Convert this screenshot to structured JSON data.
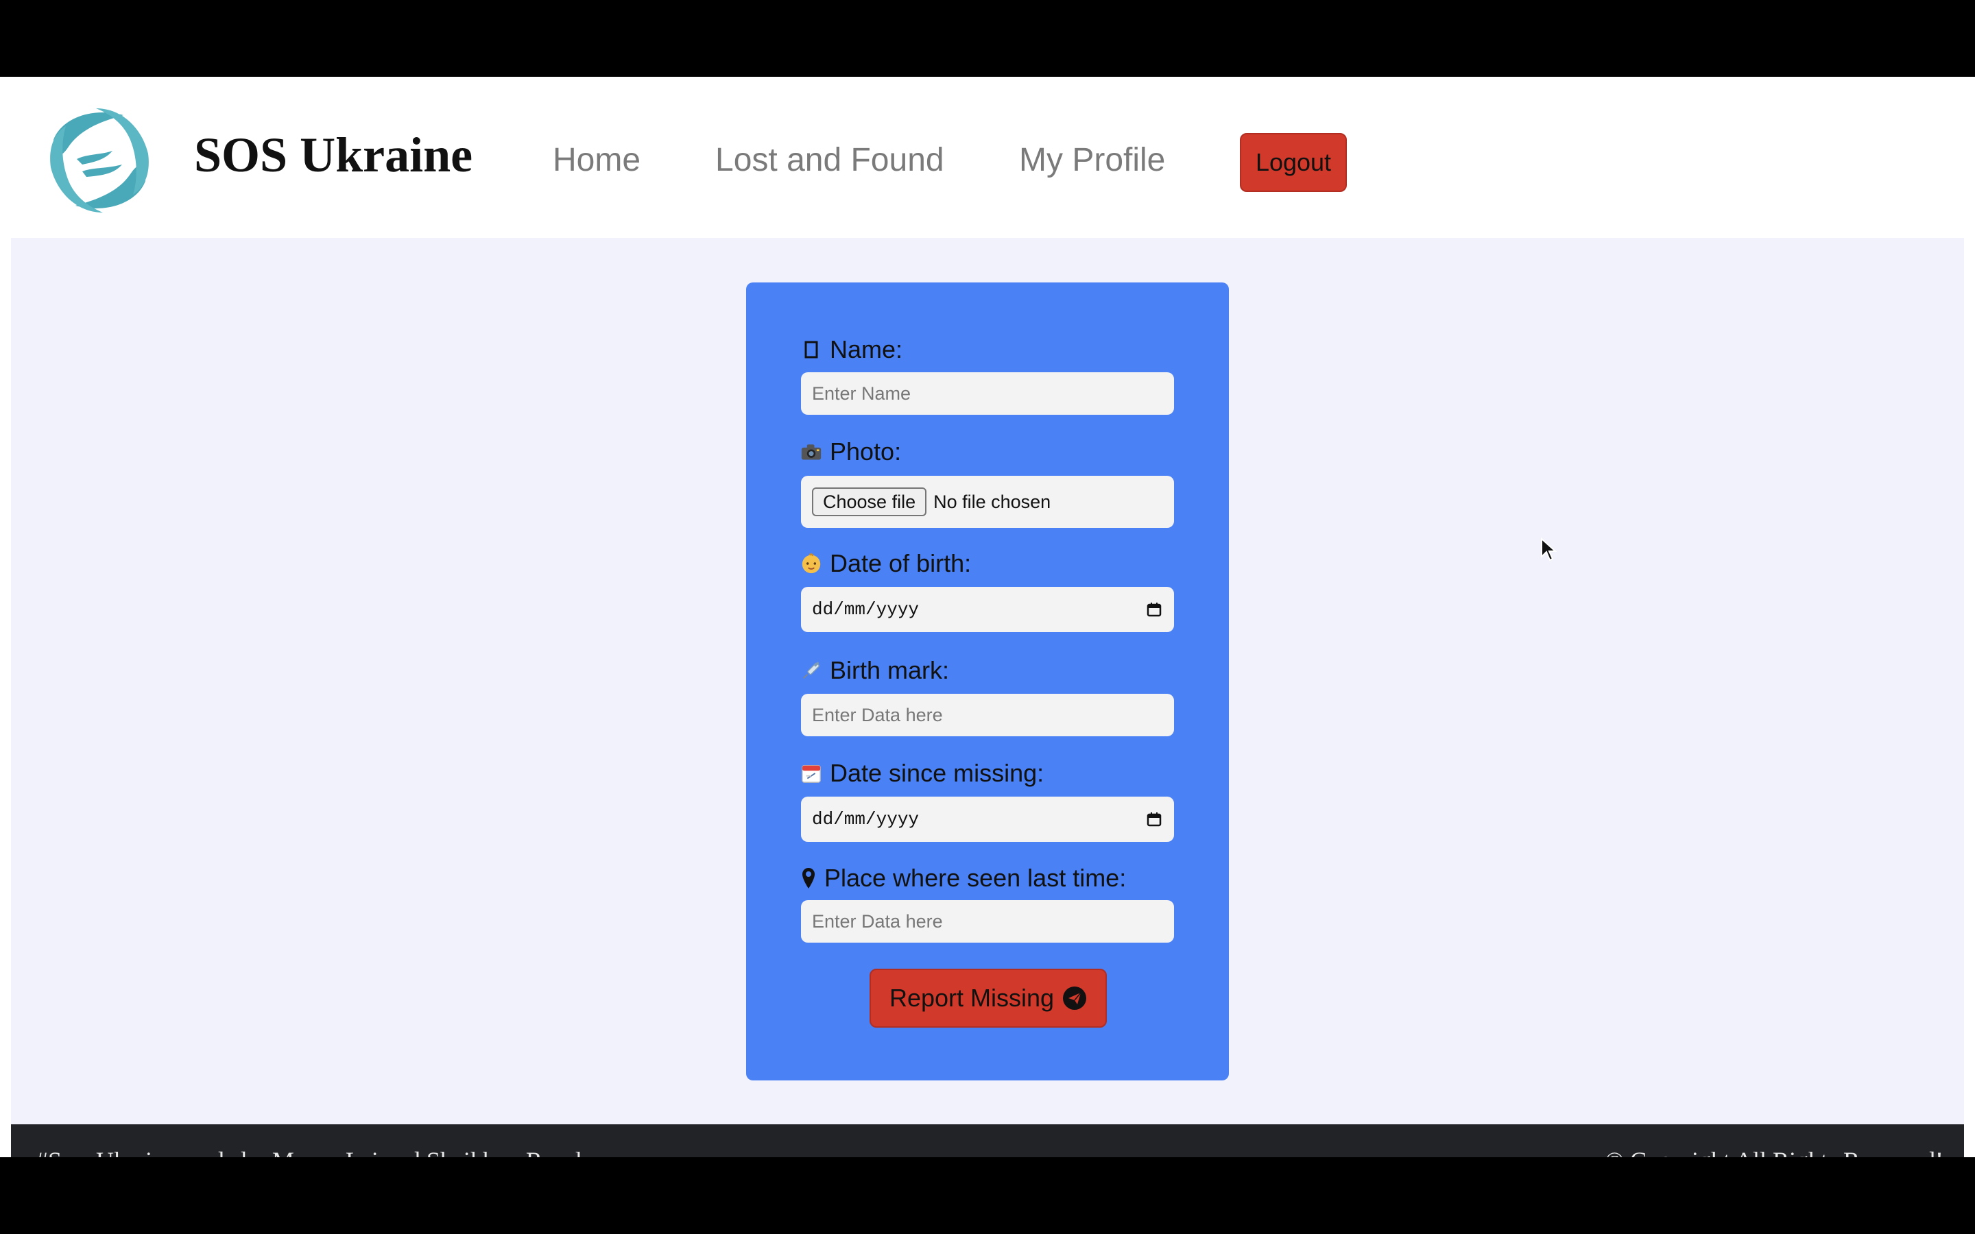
{
  "header": {
    "brand": "SOS Ukraine",
    "logo_icon": "hands-globe-logo",
    "nav": {
      "home": "Home",
      "lost_and_found": "Lost and Found",
      "my_profile": "My Profile"
    },
    "logout_label": "Logout"
  },
  "form": {
    "name": {
      "label": "Name:",
      "icon": "user-icon",
      "placeholder": "Enter Name",
      "value": ""
    },
    "photo": {
      "label": "Photo:",
      "icon": "camera-icon",
      "button": "Choose file",
      "status": "No file chosen"
    },
    "dob": {
      "label": "Date of birth:",
      "icon": "baby-face-icon",
      "value": "dd/mm/yyyy"
    },
    "birth_mark": {
      "label": "Birth mark:",
      "icon": "syringe-icon",
      "placeholder": "Enter Data here",
      "value": ""
    },
    "date_missing": {
      "label": "Date since missing:",
      "icon": "calendar-icon",
      "value": "dd/mm/yyyy"
    },
    "place": {
      "label": "Place where seen last time:",
      "icon": "map-marker-icon",
      "placeholder": "Enter Data here",
      "value": ""
    },
    "submit_label": "Report Missing",
    "submit_icon": "telegram-send-icon"
  },
  "footer": {
    "left": "#SaveUkraine made by Myron Lyi and Sheikhov Rasul",
    "right": "© Copyright All Rights Reserved!"
  },
  "colors": {
    "card": "#4a81f4",
    "accent_red": "#d13a2a",
    "page_bg": "#f2f2fc",
    "footer_bg": "#222326"
  }
}
